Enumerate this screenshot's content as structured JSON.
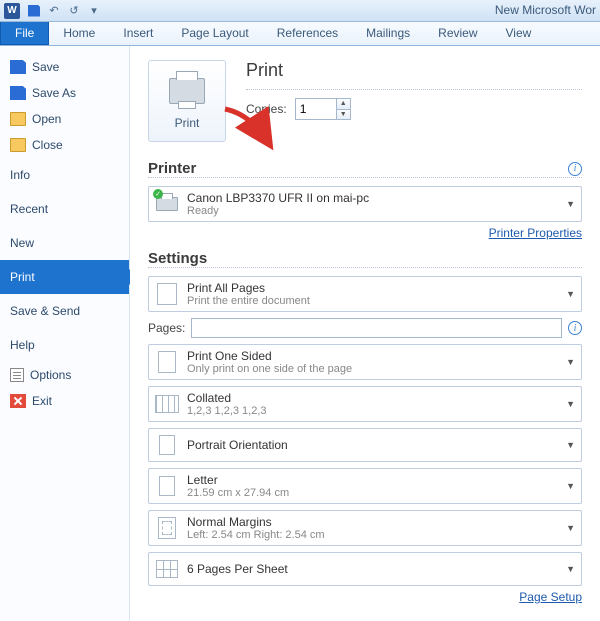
{
  "window": {
    "title": "New Microsoft Wor"
  },
  "qat": {
    "undo": "↶",
    "redo": "↺",
    "cust": "▾"
  },
  "ribbon": {
    "tabs": [
      "File",
      "Home",
      "Insert",
      "Page Layout",
      "References",
      "Mailings",
      "Review",
      "View"
    ]
  },
  "sidebar": {
    "save": "Save",
    "saveas": "Save As",
    "open": "Open",
    "close": "Close",
    "info": "Info",
    "recent": "Recent",
    "new": "New",
    "print": "Print",
    "savesend": "Save & Send",
    "help": "Help",
    "options": "Options",
    "exit": "Exit"
  },
  "print": {
    "button_label": "Print",
    "heading": "Print",
    "copies_label": "Copies:",
    "copies_value": "1"
  },
  "printer": {
    "heading": "Printer",
    "name": "Canon LBP3370 UFR II on mai-pc",
    "status": "Ready",
    "properties_link": "Printer Properties"
  },
  "settings": {
    "heading": "Settings",
    "all_pages_title": "Print All Pages",
    "all_pages_sub": "Print the entire document",
    "pages_label": "Pages:",
    "pages_value": "",
    "one_sided_title": "Print One Sided",
    "one_sided_sub": "Only print on one side of the page",
    "collated_title": "Collated",
    "collated_sub": "1,2,3   1,2,3   1,2,3",
    "orientation_title": "Portrait Orientation",
    "paper_title": "Letter",
    "paper_sub": "21.59 cm x 27.94 cm",
    "margins_title": "Normal Margins",
    "margins_sub": "Left: 2.54 cm   Right: 2.54 cm",
    "multi_title": "6 Pages Per Sheet",
    "page_setup_link": "Page Setup"
  }
}
